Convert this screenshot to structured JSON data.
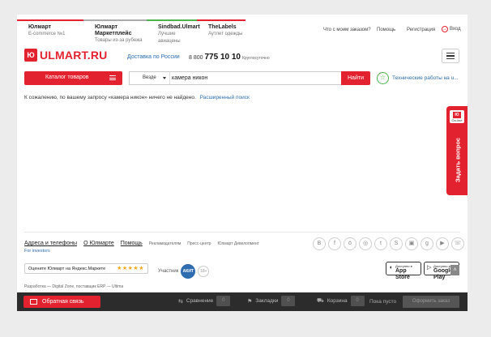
{
  "topbar": {
    "site_tabs": [
      {
        "title": "Юлмарт",
        "subtitle": "E-commerce №1"
      },
      {
        "title": "Юлмарт Маркетплейс",
        "subtitle": "Товары из-за рубежа"
      },
      {
        "title": "Sindbad.Ulmart",
        "subtitle": "Лучшие авиацены"
      },
      {
        "title": "TheLabels",
        "subtitle": "Аутлет одежды"
      }
    ],
    "links": {
      "order_status": "Что с моим заказом?",
      "help": "Помощь",
      "register": "Регистрация",
      "login": "Вход"
    }
  },
  "header": {
    "logo_mark": "Ю",
    "logo_text": "ULMART.RU",
    "delivery": "Доставка по России",
    "phone_prefix": "8 800",
    "phone_number": "775 10 10",
    "phone_note": "Круглосуточно"
  },
  "search": {
    "catalog_label": "Каталог товаров",
    "scope": "Везде",
    "query": "камера никон",
    "submit": "Найти",
    "tech_notice": "Технические работы на u..."
  },
  "results": {
    "message": "К сожалению, по вашему запросу «камера никон» ничего не найдено.",
    "advanced_link": "Расширенный поиск"
  },
  "online_widget": {
    "badge": "Ю",
    "status": "On-line",
    "ask": "Задать вопрос"
  },
  "footer": {
    "links": {
      "addresses": "Адреса и телефоны",
      "about": "О Юлмарте",
      "help": "Помощь",
      "advertisers": "Рекламодателям",
      "press": "Пресс-центр",
      "development": "Юлмарт Девелопмент"
    },
    "investors": "For investors",
    "social_icons": [
      "vk-icon",
      "facebook-icon",
      "odnoklassniki-icon",
      "moikrug-icon",
      "twitter-icon",
      "skype-icon",
      "instagram-icon",
      "google-plus-icon",
      "youtube-icon",
      "viber-icon"
    ],
    "rating": {
      "label": "Оцените Юлмарт на Яндекс.Маркете",
      "stars": "★★★★★"
    },
    "akit": {
      "label": "Участник",
      "badge": "АКИТ",
      "age": "18+"
    },
    "apps": {
      "appstore_small": "Доступно в",
      "appstore": "App Store",
      "googleplay_small": "Доступно в",
      "googleplay": "Google Play"
    },
    "credits": "Разработка — Digital Zone, поставщик ERP — Ultima"
  },
  "bottombar": {
    "feedback": "Обратная связь",
    "compare": "Сравнение",
    "compare_count": "0",
    "bookmarks": "Закладки",
    "bookmarks_count": "0",
    "cart": "Корзина",
    "cart_count": "0",
    "cart_status": "Пока пусто",
    "checkout": "Оформить заказ"
  }
}
